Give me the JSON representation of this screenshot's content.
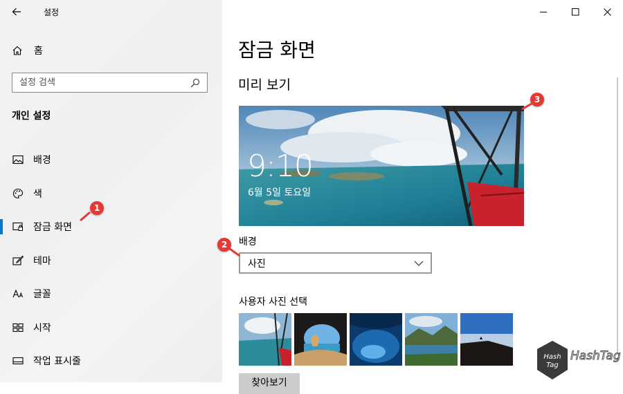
{
  "window": {
    "title": "설정",
    "controls": [
      "minimize-icon",
      "maximize-icon",
      "close-icon"
    ]
  },
  "sidebar": {
    "home_label": "홈",
    "search_placeholder": "설정 검색",
    "section_title": "개인 설정",
    "items": [
      {
        "label": "배경",
        "icon": "image-icon"
      },
      {
        "label": "색",
        "icon": "palette-icon"
      },
      {
        "label": "잠금 화면",
        "icon": "lock-screen-icon",
        "active": true
      },
      {
        "label": "테마",
        "icon": "theme-brush-icon"
      },
      {
        "label": "글꼴",
        "icon": "font-icon"
      },
      {
        "label": "시작",
        "icon": "start-grid-icon"
      },
      {
        "label": "작업 표시줄",
        "icon": "taskbar-icon"
      }
    ]
  },
  "main": {
    "page_title": "잠금 화면",
    "preview_title": "미리 보기",
    "preview": {
      "time": "9:10",
      "date": "6월 5일 토요일"
    },
    "background_label": "배경",
    "background_value": "사진",
    "choose_photo_label": "사용자 사진 선택",
    "browse_label": "찾아보기"
  },
  "annotations": [
    "1",
    "2",
    "3"
  ],
  "watermark": {
    "text": "HashTag",
    "badge_top": "Hash",
    "badge_bottom": "Tag"
  },
  "colors": {
    "accent": "#0078d4",
    "badge": "#e53935"
  }
}
